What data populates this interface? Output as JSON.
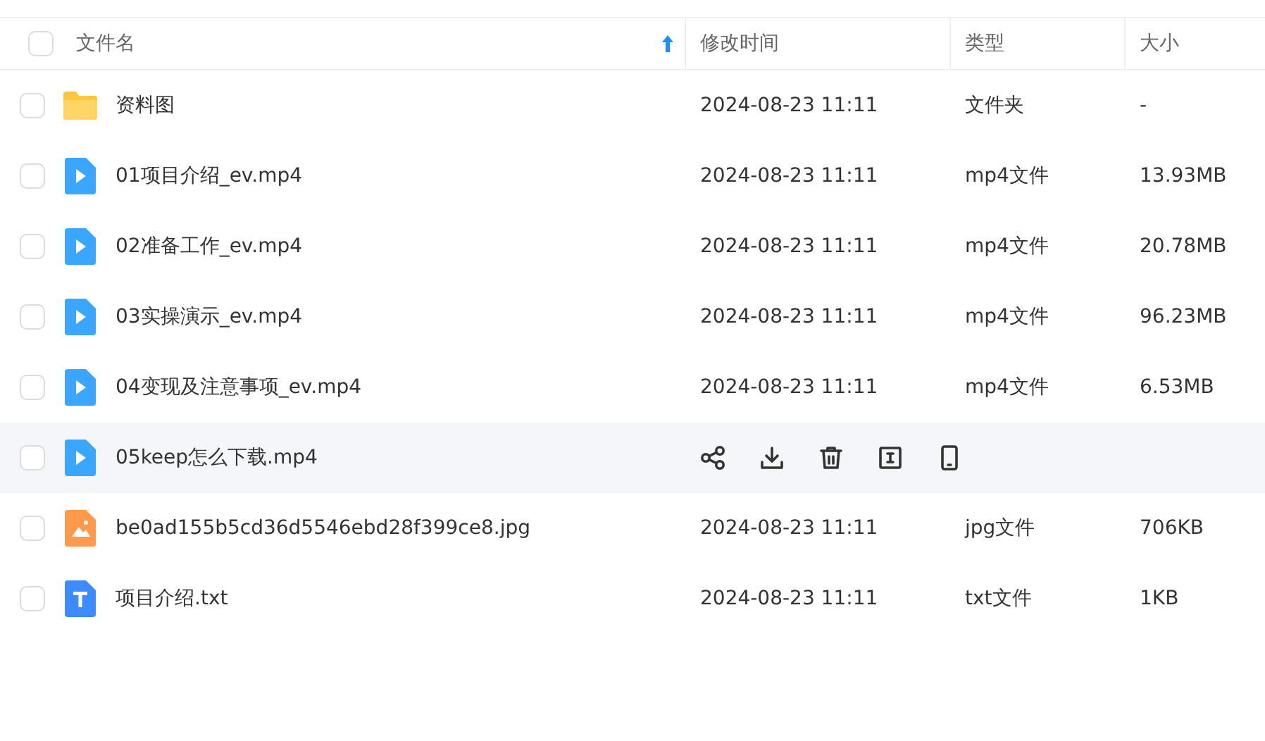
{
  "table": {
    "columns": [
      {
        "label": "文件名",
        "sorted": true
      },
      {
        "label": "修改时间",
        "sorted": false
      },
      {
        "label": "类型",
        "sorted": false
      },
      {
        "label": "大小",
        "sorted": false
      }
    ],
    "header_checked": false,
    "rows": [
      {
        "kind": "folder",
        "name": "资料图",
        "modified": "2024-08-23 11:11",
        "type": "文件夹",
        "size": "-",
        "checked": false,
        "hovered": false
      },
      {
        "kind": "video",
        "name": "01项目介绍_ev.mp4",
        "modified": "2024-08-23 11:11",
        "type": "mp4文件",
        "size": "13.93MB",
        "checked": false,
        "hovered": false
      },
      {
        "kind": "video",
        "name": "02准备工作_ev.mp4",
        "modified": "2024-08-23 11:11",
        "type": "mp4文件",
        "size": "20.78MB",
        "checked": false,
        "hovered": false
      },
      {
        "kind": "video",
        "name": "03实操演示_ev.mp4",
        "modified": "2024-08-23 11:11",
        "type": "mp4文件",
        "size": "96.23MB",
        "checked": false,
        "hovered": false
      },
      {
        "kind": "video",
        "name": "04变现及注意事项_ev.mp4",
        "modified": "2024-08-23 11:11",
        "type": "mp4文件",
        "size": "6.53MB",
        "checked": false,
        "hovered": false
      },
      {
        "kind": "video",
        "name": "05keep怎么下载.mp4",
        "checked": false,
        "hovered": true,
        "actions": [
          {
            "kind": "share"
          },
          {
            "kind": "download"
          },
          {
            "kind": "delete"
          },
          {
            "kind": "rename"
          },
          {
            "kind": "phone"
          }
        ]
      },
      {
        "kind": "image",
        "name": "be0ad155b5cd36d5546ebd28f399ce8.jpg",
        "modified": "2024-08-23 11:11",
        "type": "jpg文件",
        "size": "706KB",
        "checked": false,
        "hovered": false
      },
      {
        "kind": "text",
        "name": "项目介绍.txt",
        "modified": "2024-08-23 11:11",
        "type": "txt文件",
        "size": "1KB",
        "checked": false,
        "hovered": false
      }
    ]
  }
}
